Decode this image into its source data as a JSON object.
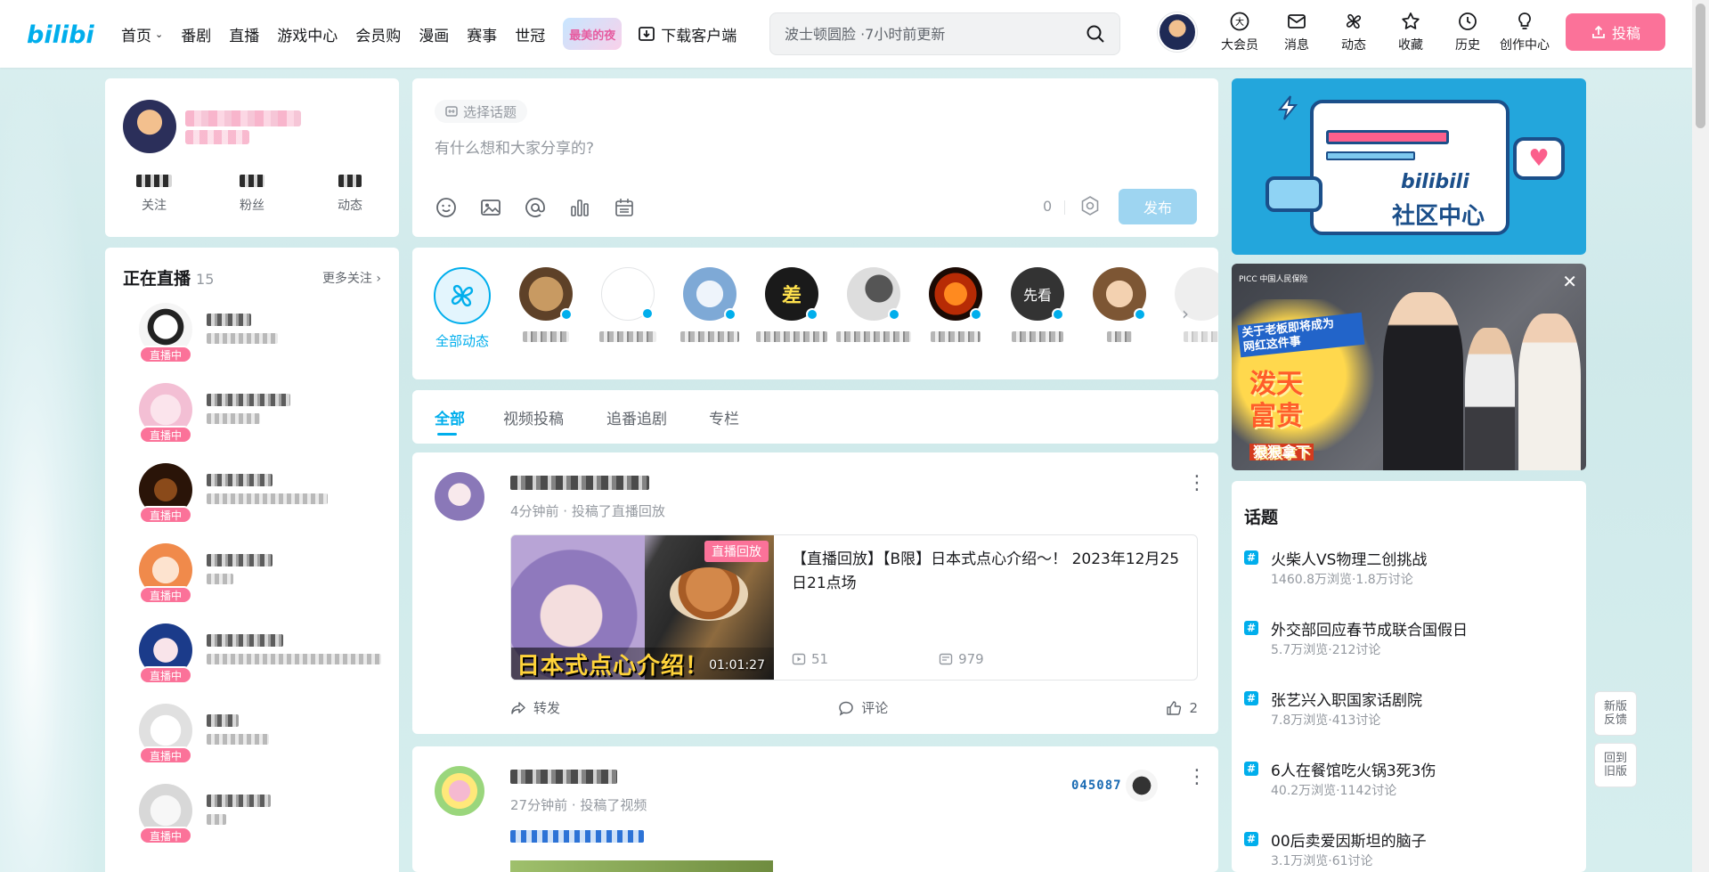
{
  "header": {
    "nav": [
      "首页",
      "番剧",
      "直播",
      "游戏中心",
      "会员购",
      "漫画",
      "赛事",
      "世冠"
    ],
    "badge": "最美的夜",
    "download": "下载客户端",
    "search_placeholder": "波士顿圆脸 ·7小时前更新",
    "icons": [
      "大会员",
      "消息",
      "动态",
      "收藏",
      "历史",
      "创作中心"
    ],
    "upload": "投稿",
    "brand_color": "#fb7299",
    "accent_color": "#00aeec"
  },
  "profile": {
    "stats": [
      "关注",
      "粉丝",
      "动态"
    ]
  },
  "live": {
    "title": "正在直播",
    "count": "15",
    "more": "更多关注",
    "tag": "直播中"
  },
  "composer": {
    "topic": "选择话题",
    "placeholder": "有什么想和大家分享的?",
    "count": "0",
    "publish": "发布"
  },
  "follow": {
    "all": "全部动态",
    "avatar_texts": [
      "差",
      "先看"
    ]
  },
  "tabs": [
    "全部",
    "视频投稿",
    "追番追剧",
    "专栏"
  ],
  "feed": [
    {
      "meta": "4分钟前 · 投稿了直播回放",
      "badge": "直播回放",
      "thumb_text": "日本式点心介绍！",
      "duration": "01:01:27",
      "title": "【直播回放】【B限】日本式点心介绍～！ 2023年12月25日21点场",
      "views": "51",
      "danmaku": "979",
      "forward": "转发",
      "comment": "评论",
      "likes": "2"
    },
    {
      "meta": "27分钟前 · 投稿了视频",
      "code": "045087"
    }
  ],
  "right": {
    "banner1_logo": "bilibili",
    "banner1_text": "社区中心",
    "banner2_lines": [
      "关于老板即将成为",
      "网红这件事",
      "泼天",
      "富贵",
      "狠狠拿下"
    ],
    "banner2_brand": "PICC 中国人民保险",
    "topics_title": "话题",
    "topics": [
      {
        "title": "火柴人VS物理二创挑战",
        "stats": "1460.8万浏览·1.8万讨论"
      },
      {
        "title": "外交部回应春节成联合国假日",
        "stats": "5.7万浏览·212讨论"
      },
      {
        "title": "张艺兴入职国家话剧院",
        "stats": "7.8万浏览·413讨论"
      },
      {
        "title": "6人在餐馆吃火锅3死3伤",
        "stats": "40.2万浏览·1142讨论"
      },
      {
        "title": "00后卖爱因斯坦的脑子",
        "stats": "3.1万浏览·61讨论"
      }
    ]
  },
  "side": {
    "feedback": "新版反馈",
    "old": "回到旧版"
  }
}
